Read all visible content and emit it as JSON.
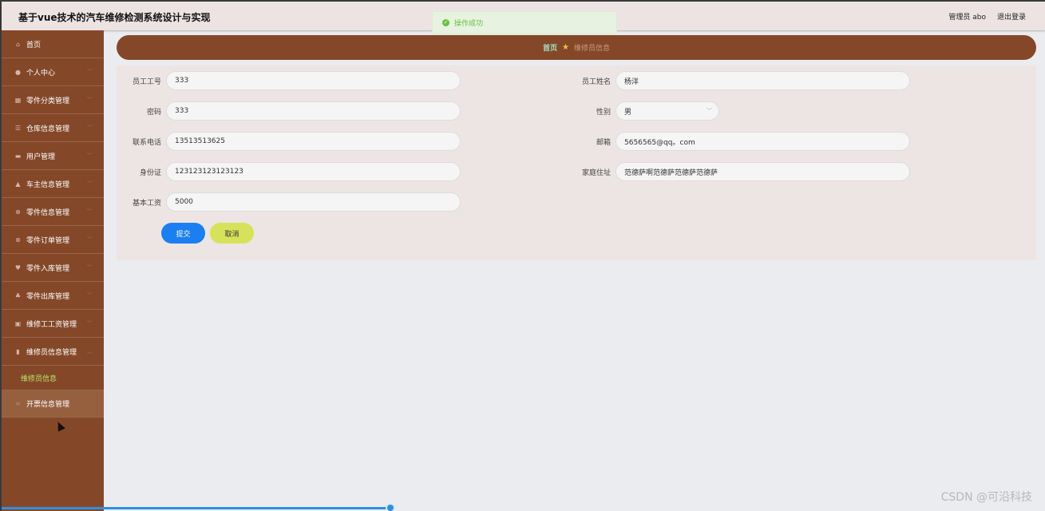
{
  "app": {
    "title": "基于vue技术的汽车维修检测系统设计与实现",
    "user_label": "管理员 abo",
    "logout_label": "退出登录"
  },
  "toast": {
    "message": "操作成功",
    "icon": "success-check-icon"
  },
  "sidebar": {
    "items": [
      {
        "label": "首页",
        "icon": "home-icon",
        "has_chevron": false
      },
      {
        "label": "个人中心",
        "icon": "user-icon",
        "has_chevron": true
      },
      {
        "label": "零件分类管理",
        "icon": "grid-icon",
        "has_chevron": true
      },
      {
        "label": "仓库信息管理",
        "icon": "list-icon",
        "has_chevron": true
      },
      {
        "label": "用户管理",
        "icon": "monitor-icon",
        "has_chevron": true
      },
      {
        "label": "车主信息管理",
        "icon": "person-icon",
        "has_chevron": true
      },
      {
        "label": "零件信息管理",
        "icon": "circle-plus-icon",
        "has_chevron": true
      },
      {
        "label": "零件订单管理",
        "icon": "globe-icon",
        "has_chevron": true
      },
      {
        "label": "零件入库管理",
        "icon": "location-pin-icon",
        "has_chevron": true
      },
      {
        "label": "零件出库管理",
        "icon": "chat-bubble-icon",
        "has_chevron": true
      },
      {
        "label": "维修工工资管理",
        "icon": "briefcase-icon",
        "has_chevron": true
      },
      {
        "label": "维修员信息管理",
        "icon": "bar-chart-icon",
        "has_chevron": true,
        "expanded": true
      }
    ],
    "sub_item": {
      "label": "维修员信息"
    },
    "last_item": {
      "label": "开票信息管理",
      "icon": "bars-icon",
      "has_chevron": false
    }
  },
  "breadcrumb": {
    "home": "首页",
    "current": "维修员信息"
  },
  "form": {
    "employee_no": {
      "label": "员工工号",
      "value": "333"
    },
    "employee_name": {
      "label": "员工姓名",
      "value": "杨洋"
    },
    "password": {
      "label": "密码",
      "value": "333"
    },
    "gender": {
      "label": "性别",
      "value": "男"
    },
    "phone": {
      "label": "联系电话",
      "value": "13513513625"
    },
    "email": {
      "label": "邮箱",
      "value": "5656565@qq。com"
    },
    "id_card": {
      "label": "身份证",
      "value": "123123123123123"
    },
    "address": {
      "label": "家庭住址",
      "value": "范德萨啊范德萨范德萨范德萨"
    },
    "salary": {
      "label": "基本工资",
      "value": "5000"
    },
    "submit_label": "提交",
    "cancel_label": "取消"
  },
  "watermark": "CSDN @可沿科技",
  "colors": {
    "sidebar_bg": "#844829",
    "submit_bg": "#1a7ff0",
    "cancel_bg": "#d8e15a",
    "active_sub": "#b8e36a",
    "toast_text": "#67c23a"
  }
}
